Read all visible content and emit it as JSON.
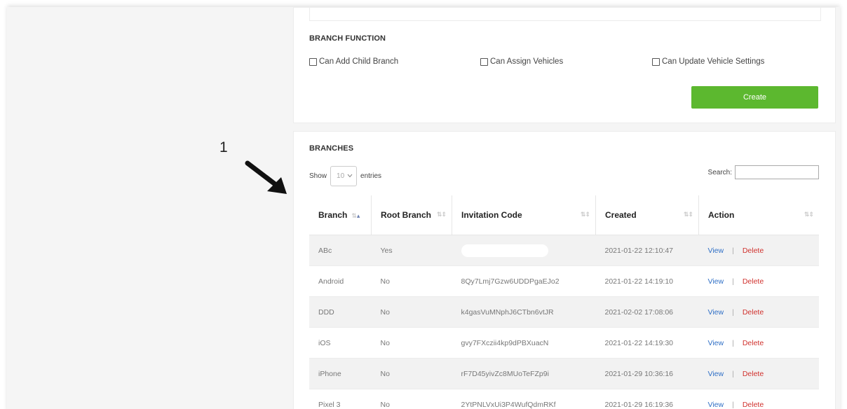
{
  "branch_function": {
    "title": "BRANCH FUNCTION",
    "options": [
      {
        "label": "Can Add Child Branch",
        "checked": false
      },
      {
        "label": "Can Assign Vehicles",
        "checked": false
      },
      {
        "label": "Can Update Vehicle Settings",
        "checked": false
      }
    ],
    "create_label": "Create",
    "create_color": "#5cb82f"
  },
  "annotation": {
    "number": "1",
    "icon": "arrow-down-right-icon"
  },
  "branches": {
    "title": "BRANCHES",
    "show_label": "Show",
    "entries_value": "10",
    "entries_label": "entries",
    "search_label": "Search:",
    "search_value": "",
    "columns": [
      "Branch",
      "Root Branch",
      "Invitation Code",
      "Created",
      "Action"
    ],
    "rows": [
      {
        "branch": "ABc",
        "root": "Yes",
        "code": "",
        "code_redacted": true,
        "created": "2021-01-22 12:10:47",
        "view": "View",
        "sep": "|",
        "delete": "Delete"
      },
      {
        "branch": "Android",
        "root": "No",
        "code": "8Qy7Lmj7Gzw6UDDPgaEJo2",
        "created": "2021-01-22 14:19:10",
        "view": "View",
        "sep": "|",
        "delete": "Delete"
      },
      {
        "branch": "DDD",
        "root": "No",
        "code": "k4gasVuMNphJ6CTbn6vtJR",
        "created": "2021-02-02 17:08:06",
        "view": "View",
        "sep": "|",
        "delete": "Delete"
      },
      {
        "branch": "iOS",
        "root": "No",
        "code": "gvy7FXczii4kp9dPBXuacN",
        "created": "2021-01-22 14:19:30",
        "view": "View",
        "sep": "|",
        "delete": "Delete"
      },
      {
        "branch": "iPhone",
        "root": "No",
        "code": "rF7D45yivZc8MUoTeFZp9i",
        "created": "2021-01-29 10:36:16",
        "view": "View",
        "sep": "|",
        "delete": "Delete"
      },
      {
        "branch": "Pixel 3",
        "root": "No",
        "code": "2YtPNLVxUi3P4WufQdmRKf",
        "created": "2021-01-29 16:19:36",
        "view": "View",
        "sep": "|",
        "delete": "Delete"
      }
    ],
    "colors": {
      "view": "#2f6fc6",
      "delete": "#d0312d"
    }
  }
}
